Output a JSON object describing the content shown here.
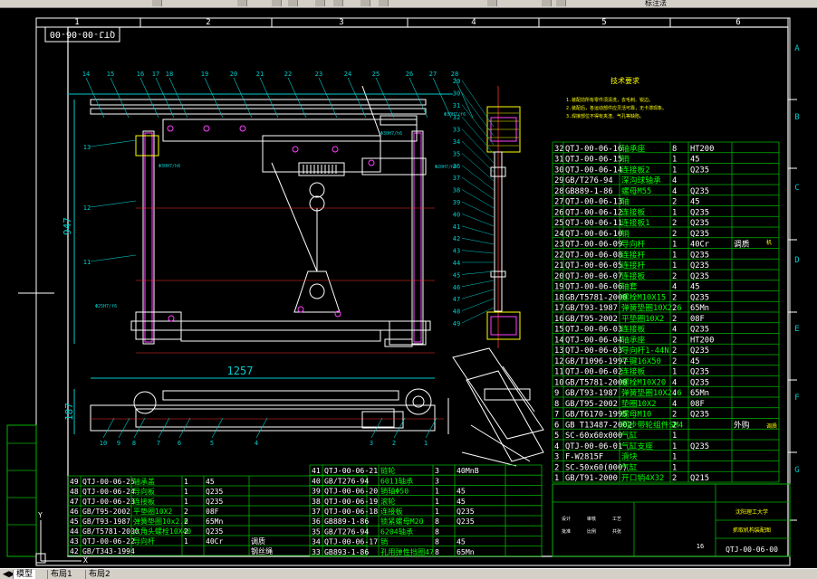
{
  "toolbar": {
    "partial_label": "标注法"
  },
  "colors": {
    "border": "#ffffff",
    "dim": "#00cccc",
    "red": "#ff3030",
    "yellow": "#ffff00",
    "magenta": "#ff40ff",
    "grid": "#00b400",
    "text_green": "#00ff00"
  },
  "sheet": {
    "grid_cols": [
      "1",
      "2",
      "3",
      "4",
      "5",
      "6"
    ],
    "grid_rows": [
      "A",
      "B",
      "C",
      "D",
      "E",
      "F",
      "G"
    ],
    "stamp": "QTJ-00-06-00",
    "tech_req_title": "技术要求",
    "tech_req_lines": [
      "1.装配前所有零件须清洗，去毛刺、锐边。",
      "2.装配后，各运动部件应灵活可靠，无卡滞现象。",
      "3.焊接部位不得有夹渣、气孔等缺陷。"
    ]
  },
  "dims": {
    "height": "947",
    "width": "1257",
    "thick": "187"
  },
  "balloons_top": [
    "14",
    "15",
    "16",
    "17",
    "18",
    "19",
    "20",
    "21",
    "22",
    "23",
    "24",
    "25",
    "26",
    "27",
    "28"
  ],
  "balloons_left": [
    "13",
    "12",
    "11"
  ],
  "balloons_right": [
    "29",
    "30",
    "31",
    "32",
    "33",
    "34",
    "35",
    "36",
    "37",
    "38",
    "39",
    "40",
    "41",
    "42",
    "43",
    "44",
    "45",
    "46",
    "47",
    "48",
    "49"
  ],
  "balloons_bottom": [
    "10",
    "9",
    "8",
    "7",
    "6",
    "5",
    "4",
    "3",
    "2",
    "1"
  ],
  "dim_notes": [
    "Φ30H7/h6",
    "Φ30H7/h6",
    "Φ20H7/h6",
    "Φ25H7/f6",
    "Φ30H7/f6"
  ],
  "bom_right": [
    [
      "32",
      "QTJ-00-06-16",
      "轴承座",
      "8",
      "HT200",
      ""
    ],
    [
      "31",
      "QTJ-00-06-15",
      "销",
      "1",
      "45",
      ""
    ],
    [
      "30",
      "QTJ-00-06-14",
      "连接板2",
      "1",
      "Q235",
      ""
    ],
    [
      "29",
      "GB/T276-94",
      "深沟球轴承",
      "4",
      "",
      ""
    ],
    [
      "28",
      "GB889-1-86",
      "螺母M55",
      "4",
      "Q235",
      ""
    ],
    [
      "27",
      "QTJ-00-06-13",
      "轴",
      "2",
      "45",
      ""
    ],
    [
      "26",
      "QTJ-00-06-12",
      "连接板",
      "1",
      "Q235",
      ""
    ],
    [
      "25",
      "QTJ-00-06-11",
      "连接板1",
      "2",
      "Q235",
      ""
    ],
    [
      "24",
      "QTJ-00-06-10",
      "销",
      "2",
      "Q235",
      ""
    ],
    [
      "23",
      "QTJ-00-06-09",
      "导向杆",
      "1",
      "40Cr",
      "调质"
    ],
    [
      "22",
      "QTJ-00-06-08",
      "连接杆",
      "1",
      "Q235",
      ""
    ],
    [
      "21",
      "QTJ-00-06-05",
      "连接杆",
      "1",
      "Q235",
      ""
    ],
    [
      "20",
      "QTJ-00-06-07",
      "连接板",
      "2",
      "Q235",
      ""
    ],
    [
      "19",
      "QTJ-00-06-06",
      "轴套",
      "4",
      "45",
      ""
    ],
    [
      "18",
      "GB/T5781-2000",
      "螺栓M10X15",
      "2",
      "Q235",
      ""
    ],
    [
      "17",
      "GB/T93-1987",
      "弹簧垫圈10X2.6",
      "2",
      "65Mn",
      ""
    ],
    [
      "16",
      "GB/T95-2002",
      "平垫圈10X2",
      "2",
      "08F",
      ""
    ],
    [
      "15",
      "QTJ-00-06-03",
      "连接板",
      "4",
      "Q235",
      ""
    ],
    [
      "14",
      "QTJ-00-06-04",
      "轴承座",
      "2",
      "HT200",
      ""
    ],
    [
      "13",
      "QTJ-00-06-03",
      "导向杆1-44N",
      "2",
      "Q235",
      ""
    ],
    [
      "12",
      "GB/T1096-1997",
      "平键16X50",
      "2",
      "45",
      ""
    ],
    [
      "11",
      "QTJ-00-06-02",
      "连接板",
      "1",
      "Q235",
      ""
    ],
    [
      "10",
      "GB/T5781-2000",
      "螺栓M10X20",
      "4",
      "Q235",
      ""
    ],
    [
      "9",
      "GB/T93-1987",
      "弹簧垫圈10X2.6",
      "4",
      "65Mn",
      ""
    ],
    [
      "8",
      "GB/T95-2002",
      "垫圈10X2",
      "4",
      "08F",
      ""
    ],
    [
      "7",
      "GB/T6170-1995",
      "螺母M10",
      "2",
      "Q235",
      ""
    ],
    [
      "6",
      "GB T13487-2002",
      "同步带轮组件SM4",
      "2",
      "",
      "外购"
    ],
    [
      "5",
      "SC-60x60x000",
      "气缸",
      "1",
      "",
      ""
    ],
    [
      "4",
      "QTJ-00-06-01",
      "气缸支座",
      "1",
      "Q235",
      ""
    ],
    [
      "3",
      "F-W2815F",
      "滑块",
      "1",
      "",
      ""
    ],
    [
      "2",
      "SC-50x60(000)",
      "气缸",
      "1",
      "",
      ""
    ],
    [
      "1",
      "GB/T91-2000",
      "开口销4X32",
      "2",
      "Q215",
      ""
    ]
  ],
  "bom_left": [
    [
      "49",
      "QTJ-00-06-25",
      "轴承盖",
      "1",
      "45",
      ""
    ],
    [
      "48",
      "QTJ-00-06-24",
      "导向板",
      "1",
      "Q235",
      ""
    ],
    [
      "47",
      "QTJ-00-06-23",
      "连接板",
      "1",
      "Q235",
      ""
    ],
    [
      "46",
      "GB/T95-2002",
      "平垫圈10X2",
      "2",
      "08F",
      ""
    ],
    [
      "45",
      "GB/T93-1987",
      "弹簧垫圈10x2.6",
      "2",
      "65Mn",
      ""
    ],
    [
      "44",
      "GB/T5781-2000",
      "六角头螺栓10X40",
      "2",
      "Q235",
      ""
    ],
    [
      "43",
      "QTJ-00-06-22",
      "导向杆",
      "1",
      "40Cr",
      "调质"
    ],
    [
      "42",
      "GB/T343-1994",
      "",
      "",
      "",
      "钢丝绳"
    ]
  ],
  "bom_mid": [
    [
      "41",
      "QTJ-00-06-21",
      "链轮",
      "3",
      "40MnB",
      ""
    ],
    [
      "40",
      "GB/T276-94",
      "6011轴承",
      "3",
      "",
      ""
    ],
    [
      "39",
      "QTJ-00-06-20",
      "销轴Φ50",
      "1",
      "45",
      ""
    ],
    [
      "38",
      "QTJ-00-06-19",
      "滚轮",
      "1",
      "45",
      ""
    ],
    [
      "37",
      "QTJ-00-06-18",
      "连接板",
      "1",
      "Q235",
      ""
    ],
    [
      "36",
      "GB889-1-86",
      "锁紧螺母M20",
      "8",
      "Q235",
      ""
    ],
    [
      "35",
      "GB/T276-94",
      "6204轴承",
      "8",
      "",
      ""
    ],
    [
      "34",
      "QTJ-00-06-17",
      "销",
      "8",
      "45",
      ""
    ],
    [
      "33",
      "GB893-1-86",
      "孔用弹性挡圈47",
      "8",
      "65Mn",
      ""
    ]
  ],
  "title_block": {
    "school": "沈阳理工大学",
    "name": "抓取机构装配图",
    "drawing_no": "QTJ-00-06-00",
    "sheets": "16",
    "labels": [
      "设计",
      "审核",
      "工艺",
      "批准",
      "比例",
      "共张"
    ]
  },
  "tabs": [
    "模型",
    "布局1",
    "布局2"
  ],
  "side_marks": [
    "机",
    "调质"
  ]
}
